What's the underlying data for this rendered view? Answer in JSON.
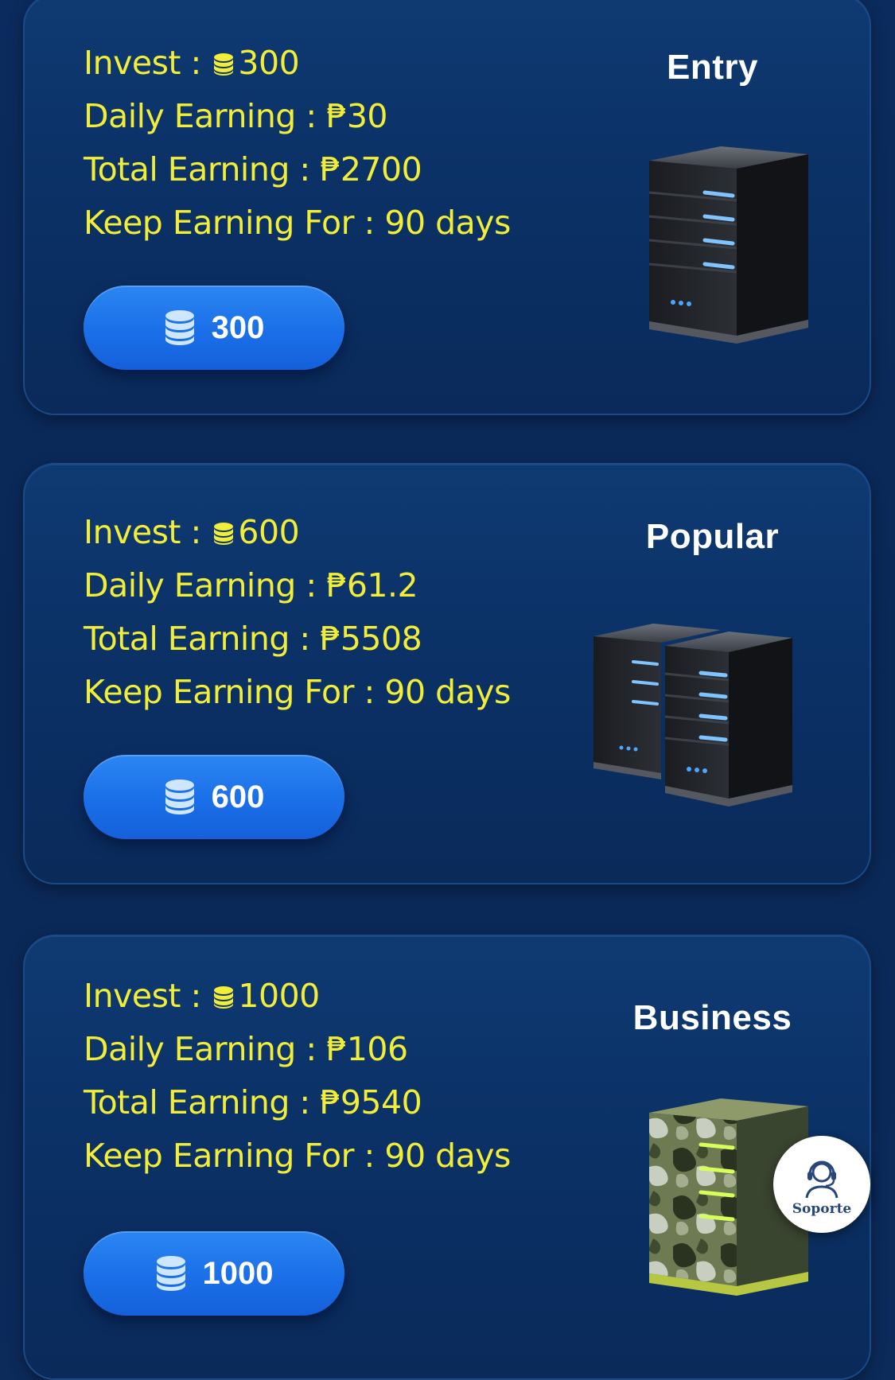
{
  "plans": [
    {
      "tier": "Entry",
      "invest_label": "Invest :",
      "invest_amount": "300",
      "daily_label": "Daily Earning :",
      "daily_value": "₱30",
      "total_label": "Total Earning :",
      "total_value": "₱2700",
      "keep_label": "Keep Earning For :",
      "keep_value": "90 days",
      "button_label": "300",
      "image": "server-single-icon"
    },
    {
      "tier": "Popular",
      "invest_label": "Invest :",
      "invest_amount": "600",
      "daily_label": "Daily Earning :",
      "daily_value": "₱61.2",
      "total_label": "Total Earning :",
      "total_value": "₱5508",
      "keep_label": "Keep Earning For :",
      "keep_value": "90 days",
      "button_label": "600",
      "image": "server-double-icon"
    },
    {
      "tier": "Business",
      "invest_label": "Invest :",
      "invest_amount": "1000",
      "daily_label": "Daily Earning :",
      "daily_value": "₱106",
      "total_label": "Total Earning :",
      "total_value": "₱9540",
      "keep_label": "Keep Earning For :",
      "keep_value": "90 days",
      "button_label": "1000",
      "image": "server-camo-icon"
    }
  ],
  "support": {
    "label": "Soporte",
    "icon": "headset-agent-icon"
  },
  "colors": {
    "background": "#0b2b5e",
    "card": "#0e3a72",
    "text_yellow": "#f2ee38",
    "button_blue": "#1a6fe8",
    "tier_white": "#ffffff"
  }
}
